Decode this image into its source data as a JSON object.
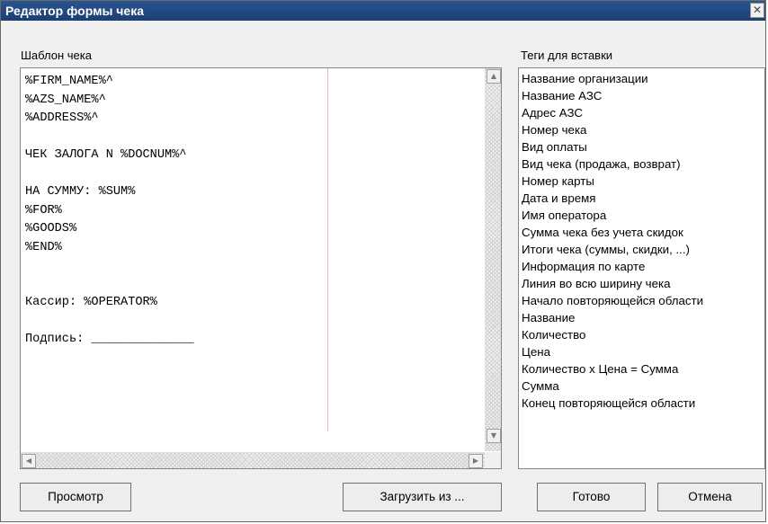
{
  "window": {
    "title": "Редактор формы чека",
    "close_symbol": "✕"
  },
  "template_panel": {
    "label": "Шаблон чека",
    "text": "%FIRM_NAME%^\n%AZS_NAME%^\n%ADDRESS%^\n\nЧЕК ЗАЛОГА N %DOCNUM%^\n\nНА СУММУ: %SUM%\n%FOR%\n%GOODS%\n%END%\n\n\nКассир: %OPERATOR%\n\nПодпись: ______________"
  },
  "tags_panel": {
    "label": "Теги для вставки",
    "items": [
      "Название организации",
      "Название АЗС",
      "Адрес АЗС",
      "Номер чека",
      "Вид оплаты",
      "Вид чека (продажа, возврат)",
      "Номер карты",
      "Дата и время",
      "Имя оператора",
      "Сумма чека без учета скидок",
      "Итоги чека (суммы, скидки, ...)",
      "Информация по карте",
      "Линия во всю ширину чека",
      "Начало повторяющейся области",
      "Название",
      "Количество",
      "Цена",
      "Количество x Цена = Сумма",
      "Сумма",
      "Конец повторяющейся области"
    ]
  },
  "buttons": {
    "preview": "Просмотр",
    "load_from": "Загрузить из ...",
    "ok": "Готово",
    "cancel": "Отмена"
  },
  "scroll_icons": {
    "up": "▲",
    "down": "▼",
    "left": "◀",
    "right": "▶"
  }
}
